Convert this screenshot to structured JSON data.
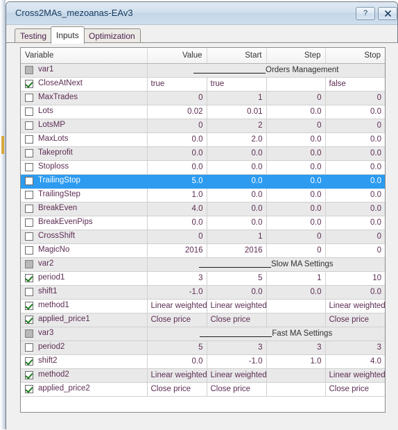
{
  "window": {
    "title": "Cross2MAs_mezoanas-EAv3",
    "help_button": "?",
    "close_button": "✕"
  },
  "tabs": [
    {
      "label": "Testing",
      "active": false
    },
    {
      "label": "Inputs",
      "active": true
    },
    {
      "label": "Optimization",
      "active": false
    }
  ],
  "table": {
    "headers": [
      "Variable",
      "Value",
      "Start",
      "Step",
      "Stop"
    ],
    "rows": [
      {
        "variable": "var1",
        "checkbox": "disabled",
        "type": "group",
        "group_label": "Orders Management",
        "selected": false
      },
      {
        "variable": "CloseAtNext",
        "checkbox": "checked",
        "type": "text",
        "value": "true",
        "start": "true",
        "step": "",
        "stop": "false",
        "selected": false
      },
      {
        "variable": "MaxTrades",
        "checkbox": "unchecked",
        "type": "num",
        "value": "0",
        "start": "1",
        "step": "0",
        "stop": "0",
        "selected": false
      },
      {
        "variable": "Lots",
        "checkbox": "unchecked",
        "type": "num",
        "value": "0.02",
        "start": "0.01",
        "step": "0.0",
        "stop": "0.0",
        "selected": false
      },
      {
        "variable": "LotsMP",
        "checkbox": "unchecked",
        "type": "num",
        "value": "0",
        "start": "2",
        "step": "0",
        "stop": "0",
        "selected": false
      },
      {
        "variable": "MaxLots",
        "checkbox": "unchecked",
        "type": "num",
        "value": "0.0",
        "start": "2.0",
        "step": "0.0",
        "stop": "0.0",
        "selected": false
      },
      {
        "variable": "Takeprofit",
        "checkbox": "unchecked",
        "type": "num",
        "value": "0.0",
        "start": "0.0",
        "step": "0.0",
        "stop": "0.0",
        "selected": false
      },
      {
        "variable": "Stoploss",
        "checkbox": "unchecked",
        "type": "num",
        "value": "0.0",
        "start": "0.0",
        "step": "0.0",
        "stop": "0.0",
        "selected": false
      },
      {
        "variable": "TrailingStop",
        "checkbox": "unchecked",
        "type": "num",
        "value": "5.0",
        "start": "0.0",
        "step": "0.0",
        "stop": "0.0",
        "selected": true
      },
      {
        "variable": "TrailingStep",
        "checkbox": "unchecked",
        "type": "num",
        "value": "1.0",
        "start": "0.0",
        "step": "0.0",
        "stop": "0.0",
        "selected": false
      },
      {
        "variable": "BreakEven",
        "checkbox": "unchecked",
        "type": "num",
        "value": "4.0",
        "start": "0.0",
        "step": "0.0",
        "stop": "0.0",
        "selected": false
      },
      {
        "variable": "BreakEvenPips",
        "checkbox": "unchecked",
        "type": "num",
        "value": "0.0",
        "start": "0.0",
        "step": "0.0",
        "stop": "0.0",
        "selected": false
      },
      {
        "variable": "CrossShift",
        "checkbox": "unchecked",
        "type": "num",
        "value": "0",
        "start": "1",
        "step": "0",
        "stop": "0",
        "selected": false
      },
      {
        "variable": "MagicNo",
        "checkbox": "unchecked",
        "type": "num",
        "value": "2016",
        "start": "2016",
        "step": "0",
        "stop": "0",
        "selected": false
      },
      {
        "variable": "var2",
        "checkbox": "disabled",
        "type": "group",
        "group_label": "Slow MA Settings",
        "selected": false
      },
      {
        "variable": "period1",
        "checkbox": "checked",
        "type": "num",
        "value": "3",
        "start": "5",
        "step": "1",
        "stop": "10",
        "selected": false
      },
      {
        "variable": "shift1",
        "checkbox": "unchecked",
        "type": "num",
        "value": "-1.0",
        "start": "0.0",
        "step": "0.0",
        "stop": "0.0",
        "selected": false
      },
      {
        "variable": "method1",
        "checkbox": "checked",
        "type": "text",
        "value": "Linear weighted",
        "start": "Linear weighted",
        "step": "",
        "stop": "Linear weighted",
        "selected": false
      },
      {
        "variable": "applied_price1",
        "checkbox": "checked",
        "type": "text",
        "value": "Close price",
        "start": "Close price",
        "step": "",
        "stop": "Close price",
        "selected": false
      },
      {
        "variable": "var3",
        "checkbox": "disabled",
        "type": "group",
        "group_label": "Fast MA Settings",
        "selected": false
      },
      {
        "variable": "period2",
        "checkbox": "unchecked",
        "type": "num",
        "value": "5",
        "start": "3",
        "step": "3",
        "stop": "3",
        "selected": false
      },
      {
        "variable": "shift2",
        "checkbox": "checked",
        "type": "num",
        "value": "0.0",
        "start": "-1.0",
        "step": "1.0",
        "stop": "4.0",
        "selected": false
      },
      {
        "variable": "method2",
        "checkbox": "checked",
        "type": "text",
        "value": "Linear weighted",
        "start": "Linear weighted",
        "step": "",
        "stop": "Linear weighted",
        "selected": false
      },
      {
        "variable": "applied_price2",
        "checkbox": "checked",
        "type": "text",
        "value": "Close price",
        "start": "Close price",
        "step": "",
        "stop": "Close price",
        "selected": false
      }
    ]
  },
  "colors": {
    "selection": "#2c9bf0",
    "row_alt": "#e9e9e9",
    "variable_text": "#5c2d53",
    "title_text": "#13395e"
  }
}
